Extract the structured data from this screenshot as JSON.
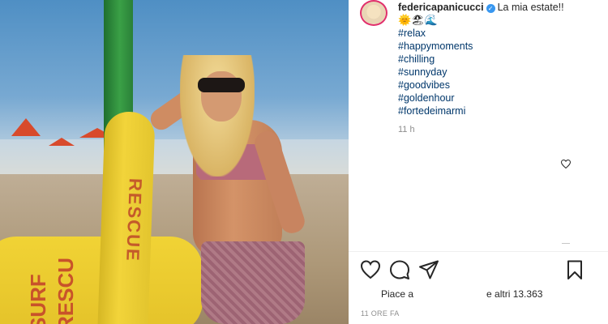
{
  "post": {
    "username": "federicapanicucci",
    "verified_icon": "verified-badge-icon",
    "caption_text": "La mia estate!!",
    "emojis": "🌞🏖🌊",
    "hashtags": [
      "#relax",
      "#happymoments",
      "#chilling",
      "#sunnyday",
      "#goodvibes",
      "#goldenhour",
      "#fortedeimarmi"
    ],
    "time_ago": "11 h",
    "likes_prefix": "Piace a",
    "likes_suffix": "e altri 13.363",
    "posted_ago": "11 ORE FA"
  },
  "photo": {
    "rescue_text": "RESCUE",
    "surf_text": "SURF RESCU"
  },
  "icons": {
    "comment_like": "heart-outline-icon",
    "like": "heart-outline-icon",
    "comment": "speech-bubble-icon",
    "share": "paper-plane-icon",
    "save": "bookmark-icon"
  },
  "colors": {
    "verified": "#3897f0",
    "hashtag": "#00376b",
    "avatar_ring": "#e1306c",
    "muted": "#8e8e8e"
  }
}
